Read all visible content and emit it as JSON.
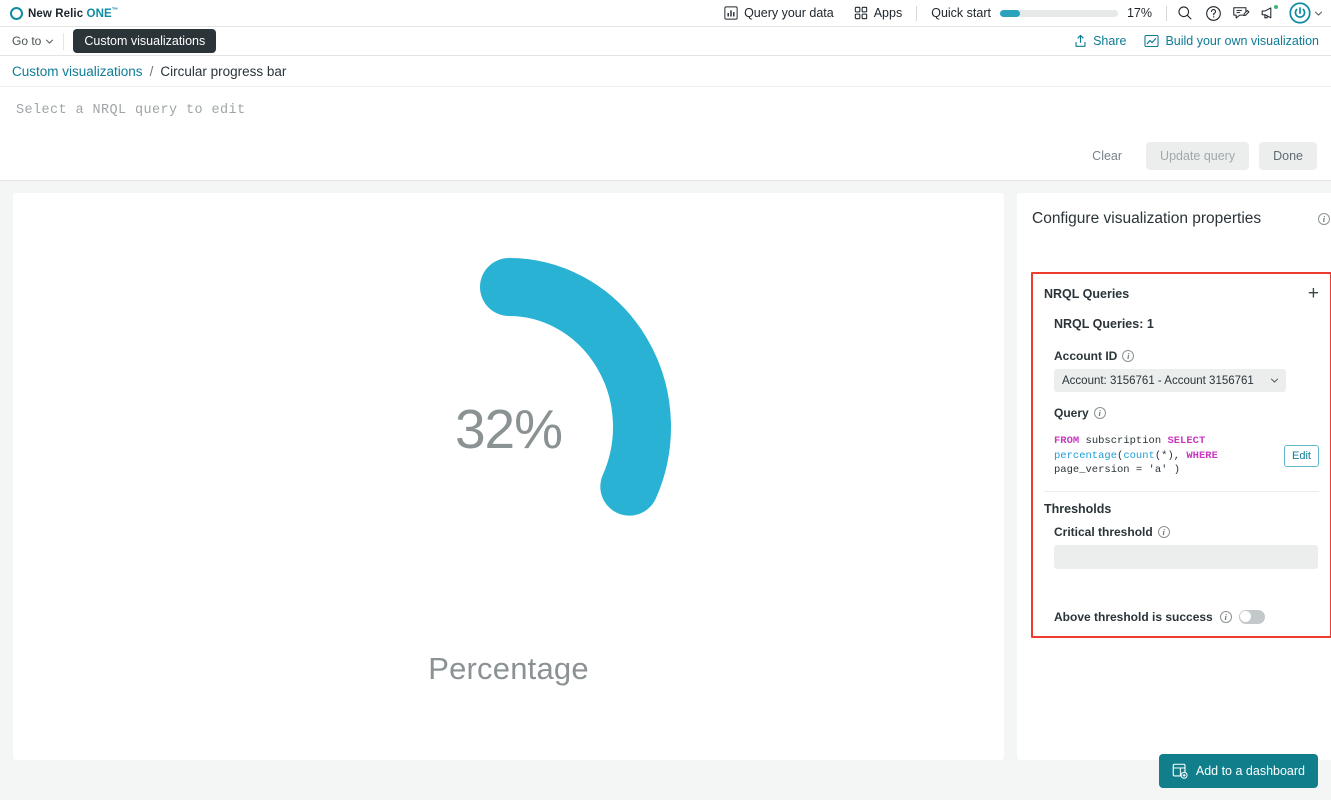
{
  "topnav": {
    "brand": {
      "name": "New Relic",
      "one": "ONE",
      "tm": "™",
      "mark_icon": "new-relic-logo-icon"
    },
    "query_your_data": "Query your data",
    "apps": "Apps",
    "quick_start_label": "Quick start",
    "quick_start_percent": "17%",
    "quick_start_value": 17,
    "icons": {
      "chart": "bar-chart-icon",
      "apps": "grid-apps-icon",
      "search": "search-icon",
      "help": "help-circle-icon",
      "feedback": "feedback-note-icon",
      "announcements": "megaphone-icon",
      "avatar": "user-avatar-icon",
      "chevron": "chevron-down-icon"
    }
  },
  "subnav": {
    "goto_label": "Go to",
    "active_tab": "Custom visualizations",
    "share_label": "Share",
    "build_label": "Build your own visualization",
    "share_icon": "share-upload-icon",
    "build_icon": "line-chart-icon"
  },
  "breadcrumb": {
    "root": "Custom visualizations",
    "separator": "/",
    "current": "Circular progress bar"
  },
  "query_editor": {
    "placeholder": "Select a NRQL query to edit",
    "clear_label": "Clear",
    "update_label": "Update query",
    "done_label": "Done"
  },
  "chart_data": {
    "type": "gauge",
    "title": "Percentage",
    "value": 32,
    "value_label": "32%",
    "min": 0,
    "max": 100,
    "unit": "%",
    "arc_color": "#29b2d4",
    "track_color": "#ffffff",
    "label_color": "#8b9294",
    "start_angle_deg": 0,
    "sweep_deg": 115.2
  },
  "panel": {
    "title": "Configure visualization properties",
    "info_icon": "info-circle-icon",
    "nrql_group": {
      "heading": "NRQL Queries",
      "add_icon": "plus-icon",
      "count_label": "NRQL Queries: 1",
      "account_label": "Account ID",
      "account_value": "Account: 3156761 - Account 3156761",
      "account_chevron": "chevron-down-icon",
      "query_label": "Query",
      "query_tokens": [
        {
          "t": "FROM",
          "k": "kw"
        },
        {
          "t": " subscription ",
          "k": ""
        },
        {
          "t": "SELECT",
          "k": "kw"
        },
        {
          "t": " ",
          "k": ""
        },
        {
          "t": "percentage",
          "k": "fn"
        },
        {
          "t": "(",
          "k": ""
        },
        {
          "t": "count",
          "k": "fn"
        },
        {
          "t": "(*), ",
          "k": ""
        },
        {
          "t": "WHERE",
          "k": "kw"
        },
        {
          "t": " page_version = 'a'\n)",
          "k": ""
        }
      ],
      "edit_label": "Edit"
    },
    "thresholds": {
      "heading": "Thresholds",
      "critical_label": "Critical threshold",
      "critical_value": "",
      "critical_placeholder": "",
      "above_label": "Above threshold is success",
      "above_state": "off"
    },
    "highlight_color": "#ef3b2d"
  },
  "footer": {
    "add_dashboard_label": "Add to a dashboard",
    "add_dashboard_icon": "dashboard-plus-icon"
  }
}
